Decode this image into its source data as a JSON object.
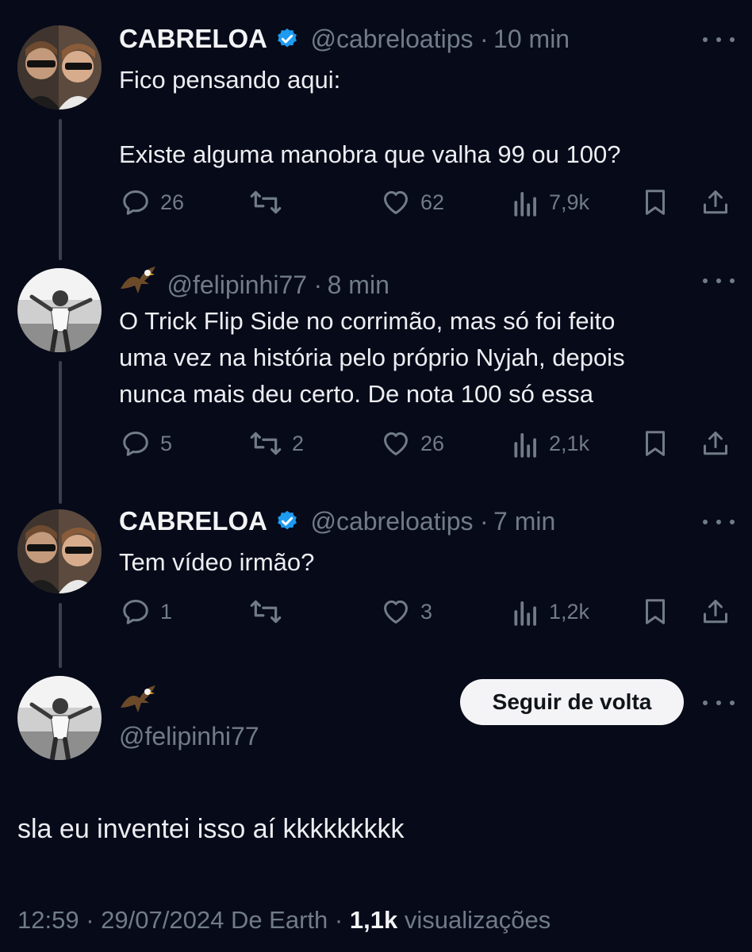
{
  "colors": {
    "background": "#070a19",
    "verified_blue": "#1d9bf0",
    "muted": "#717b8a",
    "follow_button_bg": "#f4f4f6"
  },
  "tweet1": {
    "name": "CABRELOA",
    "handle": "@cabreloatips",
    "sep": "·",
    "time": "10 min",
    "line1": "Fico pensando aqui:",
    "line2": "Existe alguma manobra que valha 99 ou 100?",
    "replies": "26",
    "retweets": "",
    "likes": "62",
    "views": "7,9k"
  },
  "tweet2": {
    "emoji": "eagle-icon",
    "handle": "@felipinhi77",
    "sep": "·",
    "time": "8 min",
    "text": "O Trick Flip Side no corrimão, mas só foi feito\numa vez na história pelo próprio Nyjah, depois\nnunca mais deu certo. De nota 100 só essa",
    "replies": "5",
    "retweets": "2",
    "likes": "26",
    "views": "2,1k"
  },
  "tweet3": {
    "name": "CABRELOA",
    "handle": "@cabreloatips",
    "sep": "·",
    "time": "7 min",
    "text": "Tem vídeo irmão?",
    "replies": "1",
    "retweets": "",
    "likes": "3",
    "views": "1,2k"
  },
  "main": {
    "emoji": "eagle-icon",
    "handle": "@felipinhi77",
    "follow_label": "Seguir de volta",
    "text": "sla eu inventei isso aí kkkkkkkkk",
    "time": "12:59",
    "sep1": "·",
    "date": "29/07/2024",
    "source": "De Earth",
    "sep2": "·",
    "views_count": "1,1k",
    "views_label": "visualizações"
  }
}
